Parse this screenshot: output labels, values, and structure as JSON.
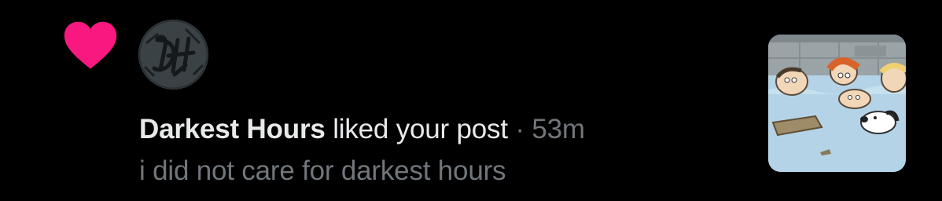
{
  "notification": {
    "type": "like",
    "icon": "heart-icon",
    "icon_color": "#f91880",
    "actor": {
      "name": "Darkest Hours",
      "avatar": "avatar-dh-monogram",
      "avatar_monogram": "DH"
    },
    "action_text": "liked your post",
    "separator": "·",
    "time": "53m",
    "post_text": "i did not care for darkest hours",
    "media": "post-image-thumbnail"
  },
  "colors": {
    "background": "#000000",
    "primary_text": "#e7e9ea",
    "secondary_text": "#71767b",
    "like_pink": "#f91880"
  }
}
